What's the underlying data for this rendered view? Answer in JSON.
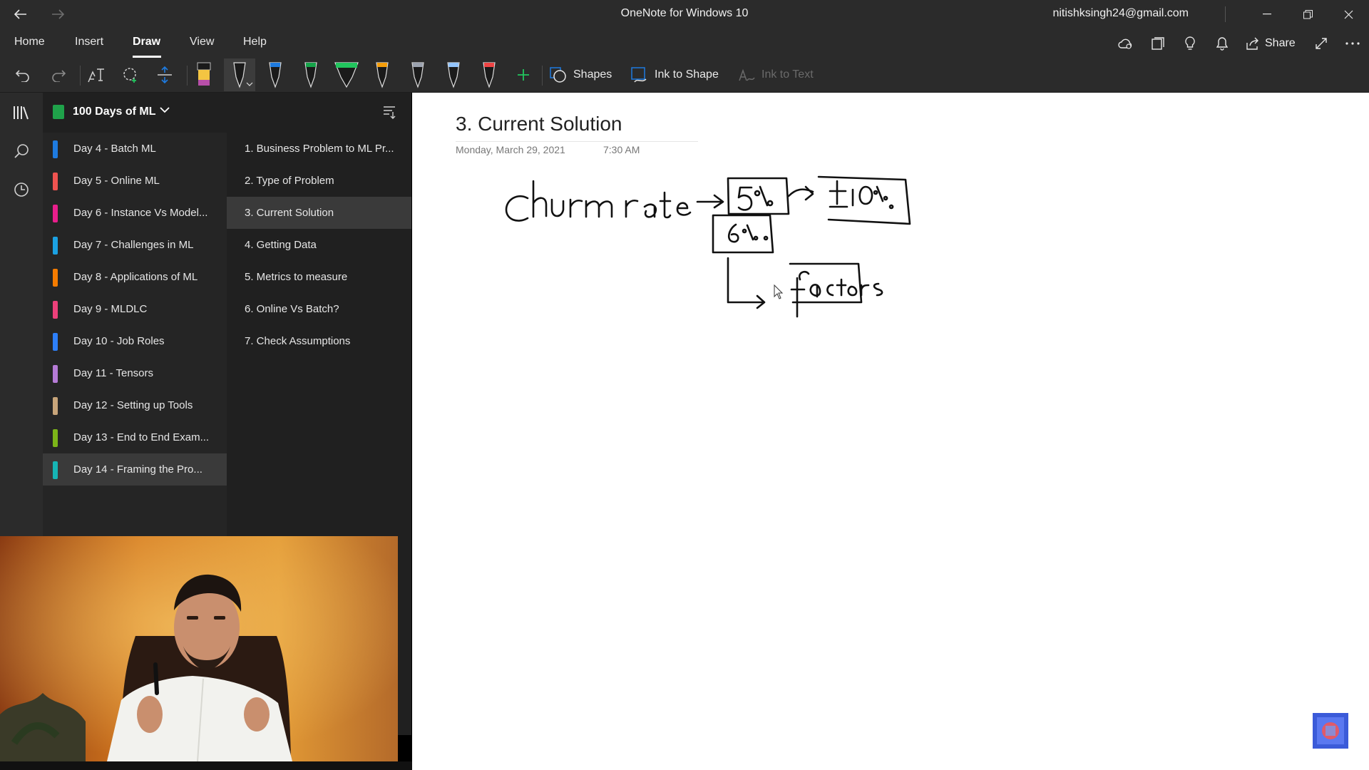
{
  "window": {
    "title": "OneNote for Windows 10",
    "account": "nitishksingh24@gmail.com"
  },
  "menu": {
    "items": [
      "Home",
      "Insert",
      "Draw",
      "View",
      "Help"
    ],
    "active": "Draw",
    "share_label": "Share"
  },
  "toolbar": {
    "shapes_label": "Shapes",
    "ink_to_shape_label": "Ink to Shape",
    "ink_to_text_label": "Ink to Text",
    "pen_colors": [
      "#222222",
      "#1e7be0",
      "#16a34a",
      "#22c55e",
      "#f59e0b",
      "#9ca3af",
      "#93c5fd",
      "#ef4444"
    ],
    "highlighter_color": "#f4c542",
    "accent": "#1fa24a"
  },
  "notebook": {
    "name": "100 Days of ML"
  },
  "sections": [
    {
      "label": "Day 4 - Batch ML",
      "color": "#1e7be0"
    },
    {
      "label": "Day 5 - Online ML",
      "color": "#ef5350"
    },
    {
      "label": "Day 6 - Instance Vs Model...",
      "color": "#e91e8c"
    },
    {
      "label": "Day 7 - Challenges in ML",
      "color": "#1ba1e2"
    },
    {
      "label": "Day 8 - Applications of ML",
      "color": "#f57c00"
    },
    {
      "label": "Day 9 - MLDLC",
      "color": "#ec407a"
    },
    {
      "label": "Day 10 - Job Roles",
      "color": "#2d7ff9"
    },
    {
      "label": "Day 11 - Tensors",
      "color": "#b57bd6"
    },
    {
      "label": "Day 12 - Setting up Tools",
      "color": "#c8a57a"
    },
    {
      "label": "Day 13 - End to End Exam...",
      "color": "#7cb518"
    },
    {
      "label": "Day 14 - Framing the Pro...",
      "color": "#16b5b5"
    }
  ],
  "selected_section": "Day 14 - Framing the Pro...",
  "pages": [
    {
      "label": "1. Business Problem to ML Pr..."
    },
    {
      "label": "2. Type of Problem"
    },
    {
      "label": "3. Current Solution"
    },
    {
      "label": "4. Getting Data"
    },
    {
      "label": "5. Metrics to measure"
    },
    {
      "label": "6. Online Vs Batch?"
    },
    {
      "label": "7. Check Assumptions"
    }
  ],
  "selected_page": "3. Current Solution",
  "note": {
    "title": "3. Current Solution",
    "date": "Monday, March 29, 2021",
    "time": "7:30 AM",
    "ink_text": [
      "Churn rate",
      "5%",
      "6%",
      "+10%",
      "factors"
    ]
  }
}
